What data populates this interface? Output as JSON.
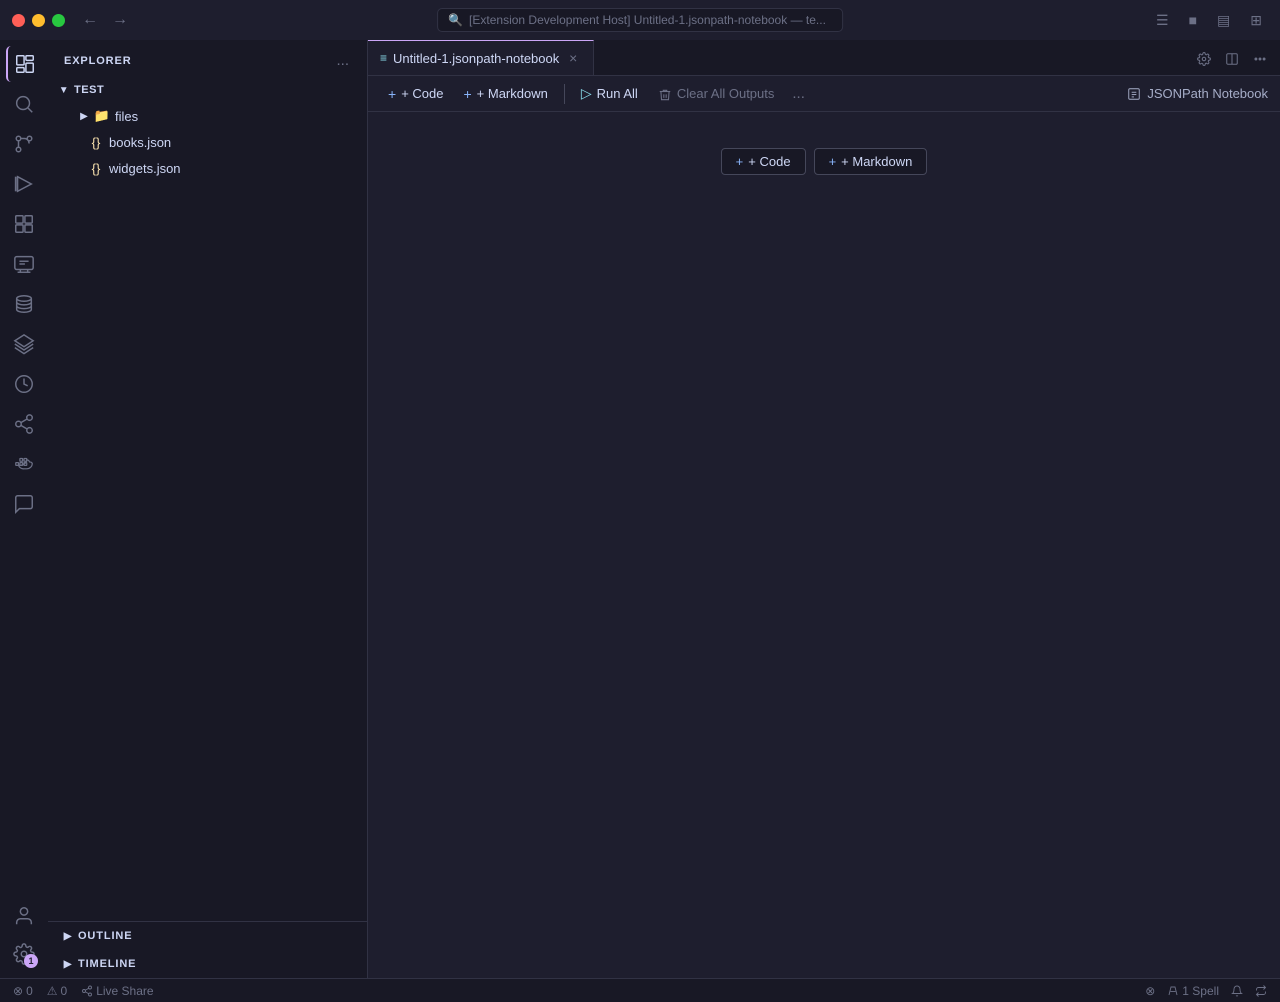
{
  "titlebar": {
    "search_text": "[Extension Development Host] Untitled-1.jsonpath-notebook — te...",
    "nav_back": "←",
    "nav_fwd": "→"
  },
  "activity_bar": {
    "icons": [
      {
        "name": "explorer-icon",
        "label": "Explorer",
        "active": true,
        "symbol": "⧉"
      },
      {
        "name": "search-icon",
        "label": "Search",
        "active": false,
        "symbol": "🔍"
      },
      {
        "name": "source-control-icon",
        "label": "Source Control",
        "active": false,
        "symbol": "⑂"
      },
      {
        "name": "run-debug-icon",
        "label": "Run and Debug",
        "active": false,
        "symbol": "▷"
      },
      {
        "name": "extensions-icon",
        "label": "Extensions",
        "active": false,
        "symbol": "⊞"
      },
      {
        "name": "remote-explorer-icon",
        "label": "Remote Explorer",
        "active": false,
        "symbol": "🖥"
      },
      {
        "name": "database-icon",
        "label": "Database",
        "active": false,
        "symbol": "🗃"
      },
      {
        "name": "layers-icon",
        "label": "Layers",
        "active": false,
        "symbol": "≡"
      },
      {
        "name": "timeline-icon",
        "label": "Timeline",
        "active": false,
        "symbol": "⏱"
      },
      {
        "name": "live-share-icon",
        "label": "Live Share",
        "active": false,
        "symbol": "↺"
      },
      {
        "name": "docker-icon",
        "label": "Docker",
        "active": false,
        "symbol": "🐳"
      },
      {
        "name": "chat-icon",
        "label": "Chat",
        "active": false,
        "symbol": "💬"
      }
    ],
    "bottom_icons": [
      {
        "name": "account-icon",
        "label": "Accounts",
        "symbol": "👤"
      },
      {
        "name": "settings-icon",
        "label": "Settings",
        "symbol": "⚙",
        "badge": "1"
      }
    ]
  },
  "sidebar": {
    "title": "Explorer",
    "more_actions": "...",
    "tree": {
      "root": "TEST",
      "items": [
        {
          "type": "folder",
          "name": "files",
          "indent": 1
        },
        {
          "type": "json",
          "name": "books.json",
          "indent": 2
        },
        {
          "type": "json",
          "name": "widgets.json",
          "indent": 2
        }
      ]
    },
    "bottom_sections": [
      {
        "name": "OUTLINE"
      },
      {
        "name": "TIMELINE"
      }
    ]
  },
  "editor": {
    "tab": {
      "icon": "≡",
      "name": "Untitled-1.jsonpath-notebook",
      "close": "×"
    },
    "tab_bar_actions": [
      {
        "name": "settings-gear",
        "symbol": "⚙"
      },
      {
        "name": "split-editor",
        "symbol": "⊡"
      },
      {
        "name": "more-actions",
        "symbol": "⋯"
      }
    ],
    "toolbar": {
      "code_label": "+ Code",
      "markdown_label": "+ Markdown",
      "run_all_label": "Run All",
      "clear_all_label": "Clear All Outputs",
      "more": "...",
      "notebook_label": "JSONPath Notebook"
    },
    "cell_buttons": [
      {
        "label": "+ Code"
      },
      {
        "label": "+ Markdown"
      }
    ]
  },
  "statusbar": {
    "left": [
      {
        "name": "error-count",
        "text": "⊗ 0"
      },
      {
        "name": "warning-count",
        "text": "⚠ 0"
      },
      {
        "name": "live-share",
        "text": "Live Share"
      }
    ],
    "right": [
      {
        "name": "remote-badge",
        "text": "⊗"
      },
      {
        "name": "spell-check",
        "text": "1 Spell"
      },
      {
        "name": "notifications",
        "text": "🔔"
      },
      {
        "name": "port-forward",
        "text": "⇄"
      }
    ]
  }
}
